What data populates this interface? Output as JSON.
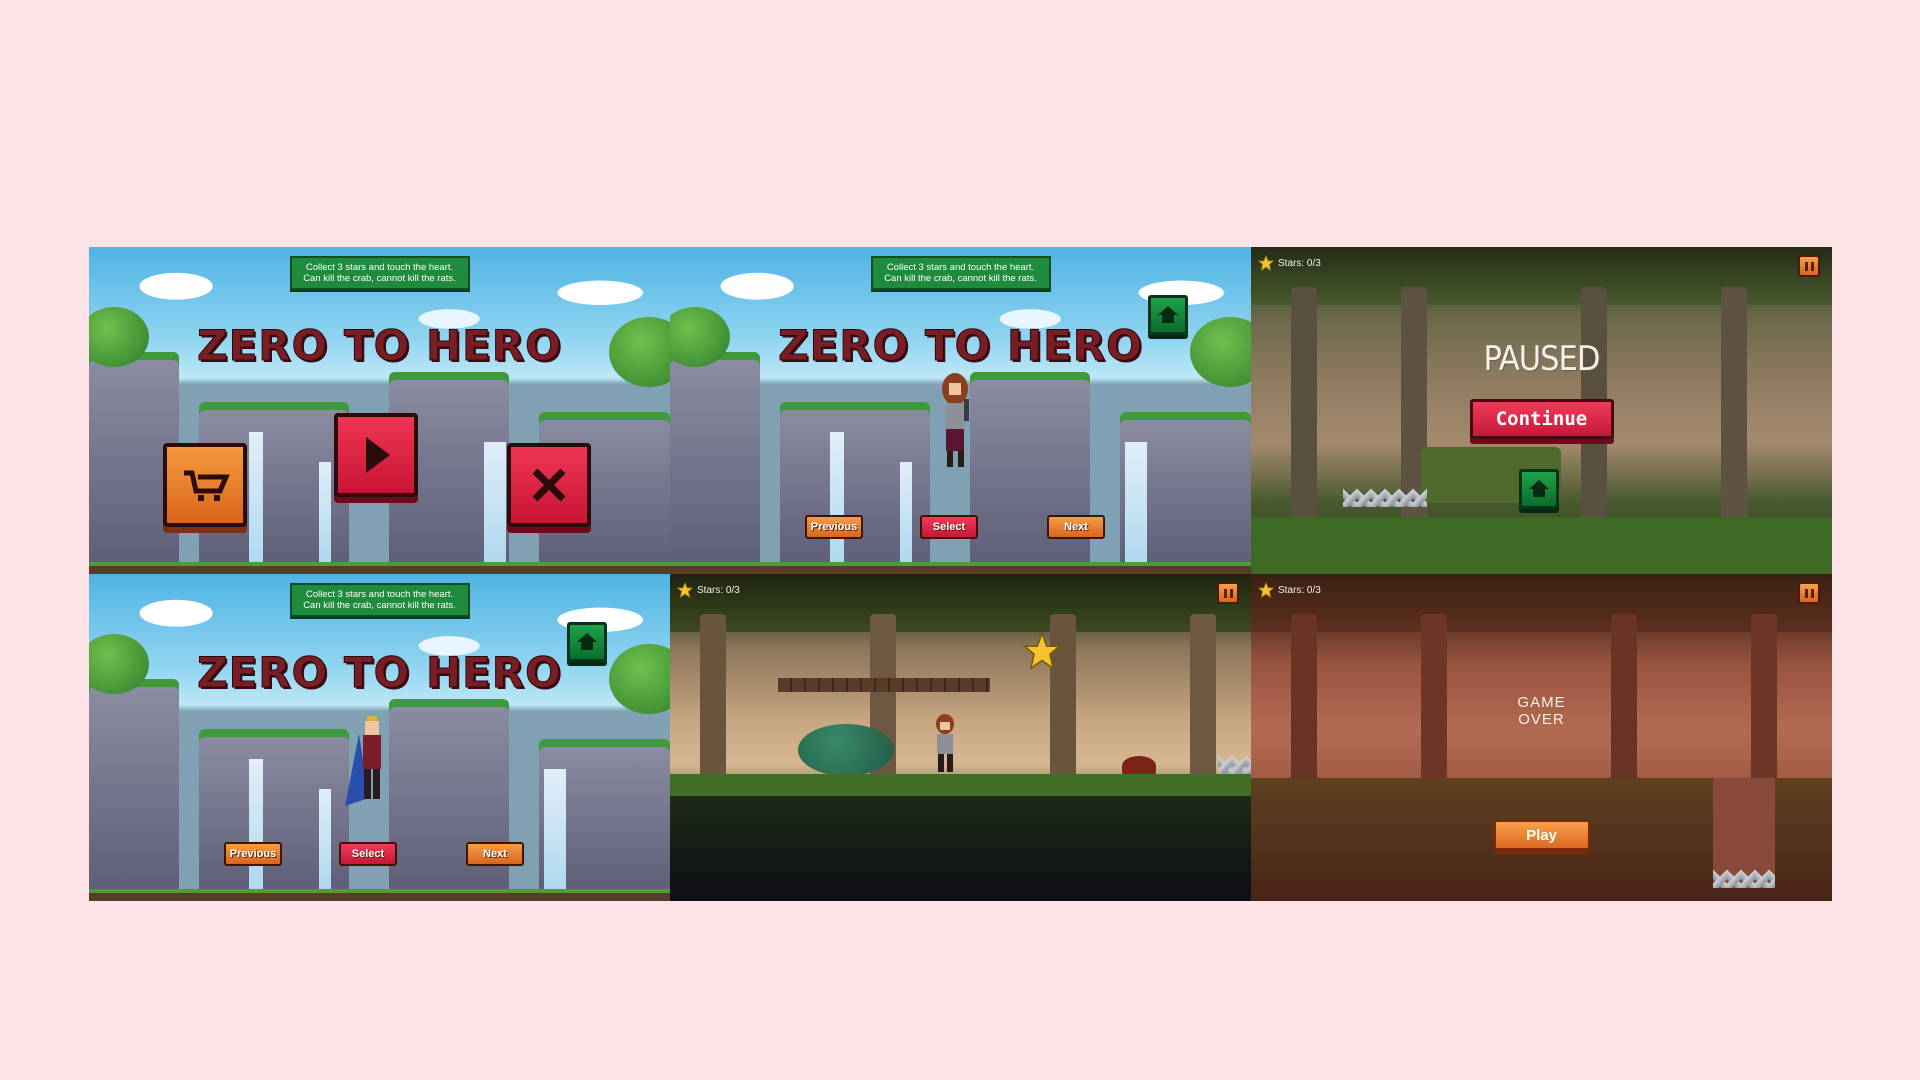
{
  "info_text_line1": "Collect 3 stars and touch the heart.",
  "info_text_line2": "Can kill the crab, cannot kill the rats.",
  "game_title": "ZERO TO HERO",
  "main_menu": {
    "buttons": [
      {
        "name": "shop-button",
        "icon": "shop-cart-icon"
      },
      {
        "name": "play-button",
        "icon": "play-icon"
      },
      {
        "name": "quit-button",
        "icon": "close-icon"
      }
    ]
  },
  "character_select": {
    "previous_label": "Previous",
    "select_label": "Select",
    "next_label": "Next",
    "home_icon": "home-icon"
  },
  "hud": {
    "stars_label": "Stars: 0/3",
    "star_icon": "star-icon",
    "pause_icon": "pause-icon"
  },
  "pause_menu": {
    "title": "PAUSED",
    "continue_label": "Continue"
  },
  "game_over": {
    "line1": "GAME",
    "line2": "OVER",
    "play_label": "Play"
  },
  "colors": {
    "background": "#fde3e6",
    "title_red": "#7a1e26",
    "info_green": "#1f8b3c",
    "button_orange": "#e07a2c",
    "button_red": "#e0254a",
    "home_green": "#148a3c"
  }
}
